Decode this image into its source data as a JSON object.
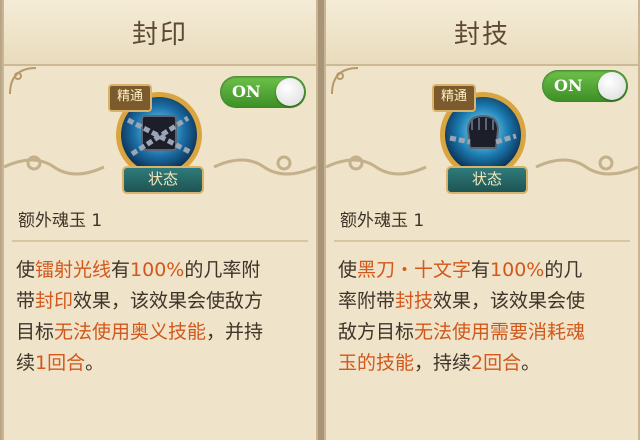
{
  "skills": [
    {
      "title": "封印",
      "toggle": "ON",
      "badge_master": "精通",
      "badge_status": "状态",
      "icon": "chained-block-icon",
      "subtitle": "额外魂玉 1",
      "desc_lines": [
        [
          {
            "t": "使",
            "hl": false
          },
          {
            "t": "镭射光线",
            "hl": true
          },
          {
            "t": "有",
            "hl": false
          },
          {
            "t": "100%",
            "hl": true
          },
          {
            "t": "的几率附",
            "hl": false
          }
        ],
        [
          {
            "t": "带",
            "hl": false
          },
          {
            "t": "封印",
            "hl": true
          },
          {
            "t": "效果，该效果会使敌方",
            "hl": false
          }
        ],
        [
          {
            "t": "目标",
            "hl": false
          },
          {
            "t": "无法使用奥义技能",
            "hl": true
          },
          {
            "t": "，并持",
            "hl": false
          }
        ],
        [
          {
            "t": "续",
            "hl": false
          },
          {
            "t": "1回合",
            "hl": true
          },
          {
            "t": "。",
            "hl": false
          }
        ]
      ]
    },
    {
      "title": "封技",
      "toggle": "ON",
      "badge_master": "精通",
      "badge_status": "状态",
      "icon": "chained-fist-icon",
      "subtitle": "额外魂玉 1",
      "desc_lines": [
        [
          {
            "t": "使",
            "hl": false
          },
          {
            "t": "黑刀・十文字",
            "hl": true
          },
          {
            "t": "有",
            "hl": false
          },
          {
            "t": "100%",
            "hl": true
          },
          {
            "t": "的几",
            "hl": false
          }
        ],
        [
          {
            "t": "率附带",
            "hl": false
          },
          {
            "t": "封技",
            "hl": true
          },
          {
            "t": "效果，该效果会使",
            "hl": false
          }
        ],
        [
          {
            "t": "敌方目标",
            "hl": false
          },
          {
            "t": "无法使用需要消耗魂",
            "hl": true
          }
        ],
        [
          {
            "t": "玉的技能",
            "hl": true
          },
          {
            "t": "，持续",
            "hl": false
          },
          {
            "t": "2回合",
            "hl": true
          },
          {
            "t": "。",
            "hl": false
          }
        ]
      ]
    }
  ],
  "colors": {
    "highlight": "#d2581b",
    "toggle_green": "#4ea832",
    "panel": "#efe3c9"
  }
}
